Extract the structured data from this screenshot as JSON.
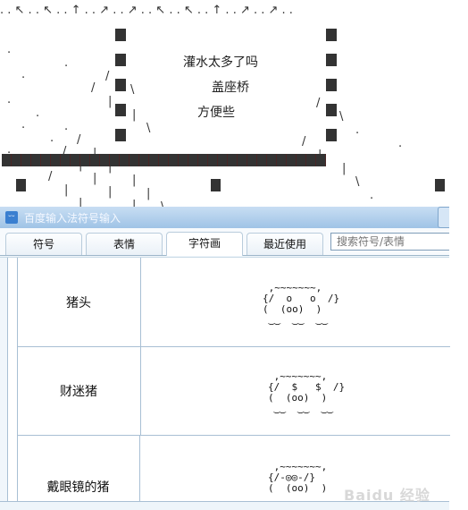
{
  "art": {
    "lines": [
      ". . ↖ . . ↖ . . ↑ . . ↗ . . ↗ . . ↖ . . ↖ . . ↑ . . ↗ . . ↗ . .",
      ".          .        / █ \\                                / █ \\  .        .",
      "     .            /  |  █  |  \\                      /  |  █  |  \\  .        .        .",
      ".        .       . /  |   |  █  |   |  \\                 /   |   |  █  |   |  \\            .",
      "     .        . /  |   |   |  █  |   |   |  \\          /  |   |   |  █  |   |   |  \\  .        .",
      ".        . /  |   |   |   |  █  |   |   |   |  \\           /   |   |   |   |  █  |   |   |   |  \\        ."
    ],
    "text_1": "灌水太多了吗",
    "text_2": "盖座桥",
    "text_3": "方便些"
  },
  "window": {
    "title": "百度输入法符号输入",
    "icon": "baidu-ime-icon"
  },
  "tabs": [
    {
      "label": "符号",
      "active": false
    },
    {
      "label": "表情",
      "active": false
    },
    {
      "label": "字符画",
      "active": true
    },
    {
      "label": "最近使用",
      "active": false
    }
  ],
  "search": {
    "placeholder": "搜索符号/表情",
    "value": ""
  },
  "rows": [
    {
      "name": "猪头",
      "art": " ,~~~~~~~,\n{/  o   o  /}\n(  (oo)  )\n ‿‿  ‿‿  ‿‿"
    },
    {
      "name": "财迷猪",
      "art": " ,~~~~~~~,\n{/  $   $  /}\n(  (oo)  )\n ‿‿  ‿‿  ‿‿"
    },
    {
      "name": "戴眼镜的猪",
      "art": " ,~~~~~~~,\n{/-◎◎-/}\n(  (oo)  )"
    }
  ],
  "watermark": "Baidu 经验"
}
